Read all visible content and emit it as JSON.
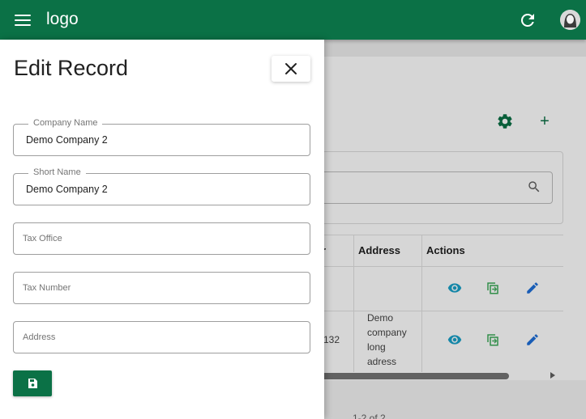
{
  "appbar": {
    "logo": "logo",
    "menu_icon": "menu-icon",
    "refresh_icon": "refresh-icon",
    "avatar_icon": "user-avatar-icon"
  },
  "drawer": {
    "title": "Edit Record",
    "close_icon": "close-icon",
    "fields": [
      {
        "label": "Company Name",
        "value": "Demo Company 2"
      },
      {
        "label": "Short Name",
        "value": "Demo Company 2"
      },
      {
        "placeholder": "Tax Office",
        "value": ""
      },
      {
        "placeholder": "Tax Number",
        "value": ""
      },
      {
        "placeholder": "Address",
        "value": ""
      }
    ],
    "save_icon": "save-icon"
  },
  "background": {
    "toolbar": {
      "settings_icon": "gear-icon",
      "add_label": "+"
    },
    "table": {
      "headers": {
        "partial": "r",
        "address": "Address",
        "actions": "Actions"
      },
      "rows": [
        {
          "partial": "",
          "address": ""
        },
        {
          "partial": "132",
          "address": "Demo company long adress"
        }
      ],
      "action_icons": [
        "eye-icon",
        "copy-icon",
        "pencil-icon"
      ]
    },
    "pager_text": "1-2 of 2"
  },
  "colors": {
    "primary": "#0b7146",
    "view": "#1aa1c9",
    "copy": "#3cab59",
    "edit": "#1e6fd9"
  }
}
